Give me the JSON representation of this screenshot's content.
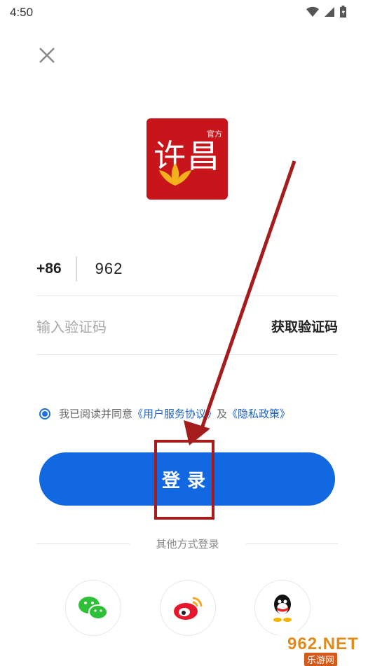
{
  "status_bar": {
    "time": "4:50"
  },
  "logo": {
    "text": "许昌",
    "badge": "官方"
  },
  "phone": {
    "country_code": "+86",
    "value": "962"
  },
  "code": {
    "placeholder": "输入验证码",
    "get_code_label": "获取验证码"
  },
  "agreement": {
    "prefix": "我已阅读并同意",
    "terms_link": "《用户服务协议》",
    "and": "及",
    "privacy_link": "《隐私政策》",
    "checked": true
  },
  "login_button": {
    "label": "登录"
  },
  "other_login": {
    "label": "其他方式登录",
    "options": [
      "wechat-icon",
      "weibo-icon",
      "qq-icon"
    ]
  },
  "watermark": {
    "top": "962.NET",
    "bottom": "乐游网"
  },
  "colors": {
    "accent": "#1268e0",
    "link": "#1a62c9",
    "annotation": "#a51c1c",
    "logo_bg": "#c8151b"
  }
}
